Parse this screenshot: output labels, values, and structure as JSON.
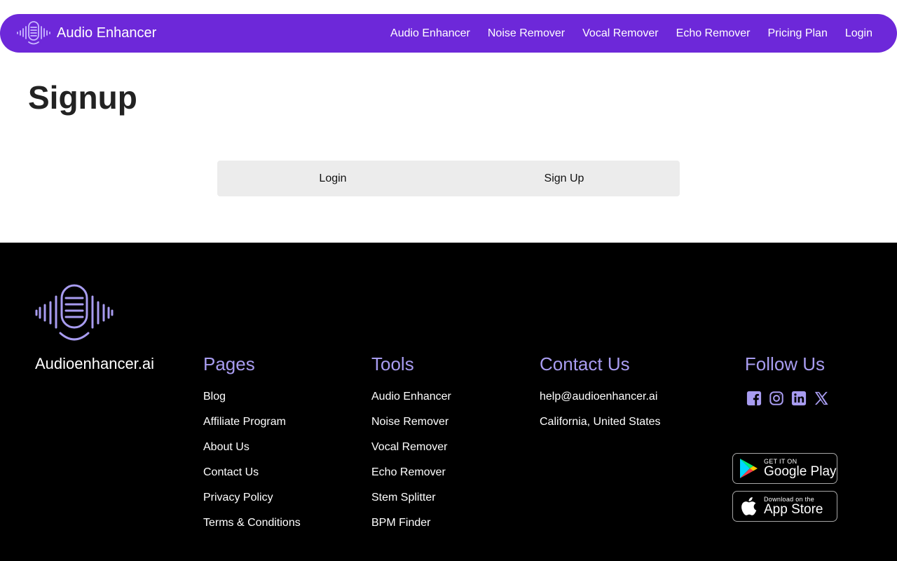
{
  "header": {
    "brand": "Audio Enhancer",
    "nav": [
      "Audio Enhancer",
      "Noise Remover",
      "Vocal Remover",
      "Echo Remover",
      "Pricing Plan",
      "Login"
    ]
  },
  "main": {
    "title": "Signup",
    "tabs": [
      "Login",
      "Sign Up"
    ]
  },
  "footer": {
    "brand": "Audioenhancer.ai",
    "pages": {
      "heading": "Pages",
      "items": [
        "Blog",
        "Affiliate Program",
        "About Us",
        "Contact Us",
        "Privacy Policy",
        "Terms & Conditions"
      ]
    },
    "tools": {
      "heading": "Tools",
      "items": [
        "Audio Enhancer",
        "Noise Remover",
        "Vocal Remover",
        "Echo Remover",
        "Stem Splitter",
        "BPM Finder"
      ]
    },
    "contact": {
      "heading": "Contact Us",
      "email": "help@audioenhancer.ai",
      "location": "California, United States"
    },
    "follow": {
      "heading": "Follow Us",
      "icons": [
        "facebook-icon",
        "instagram-icon",
        "linkedin-icon",
        "x-icon"
      ]
    },
    "badges": {
      "google_small": "GET IT ON",
      "google_big": "Google Play",
      "apple_small": "Download on the",
      "apple_big": "App Store"
    }
  },
  "colors": {
    "nav_bg": "#6d28d9",
    "footer_heading": "#a89cf0",
    "footer_bg": "#000000",
    "tabs_bg": "#ececec"
  }
}
